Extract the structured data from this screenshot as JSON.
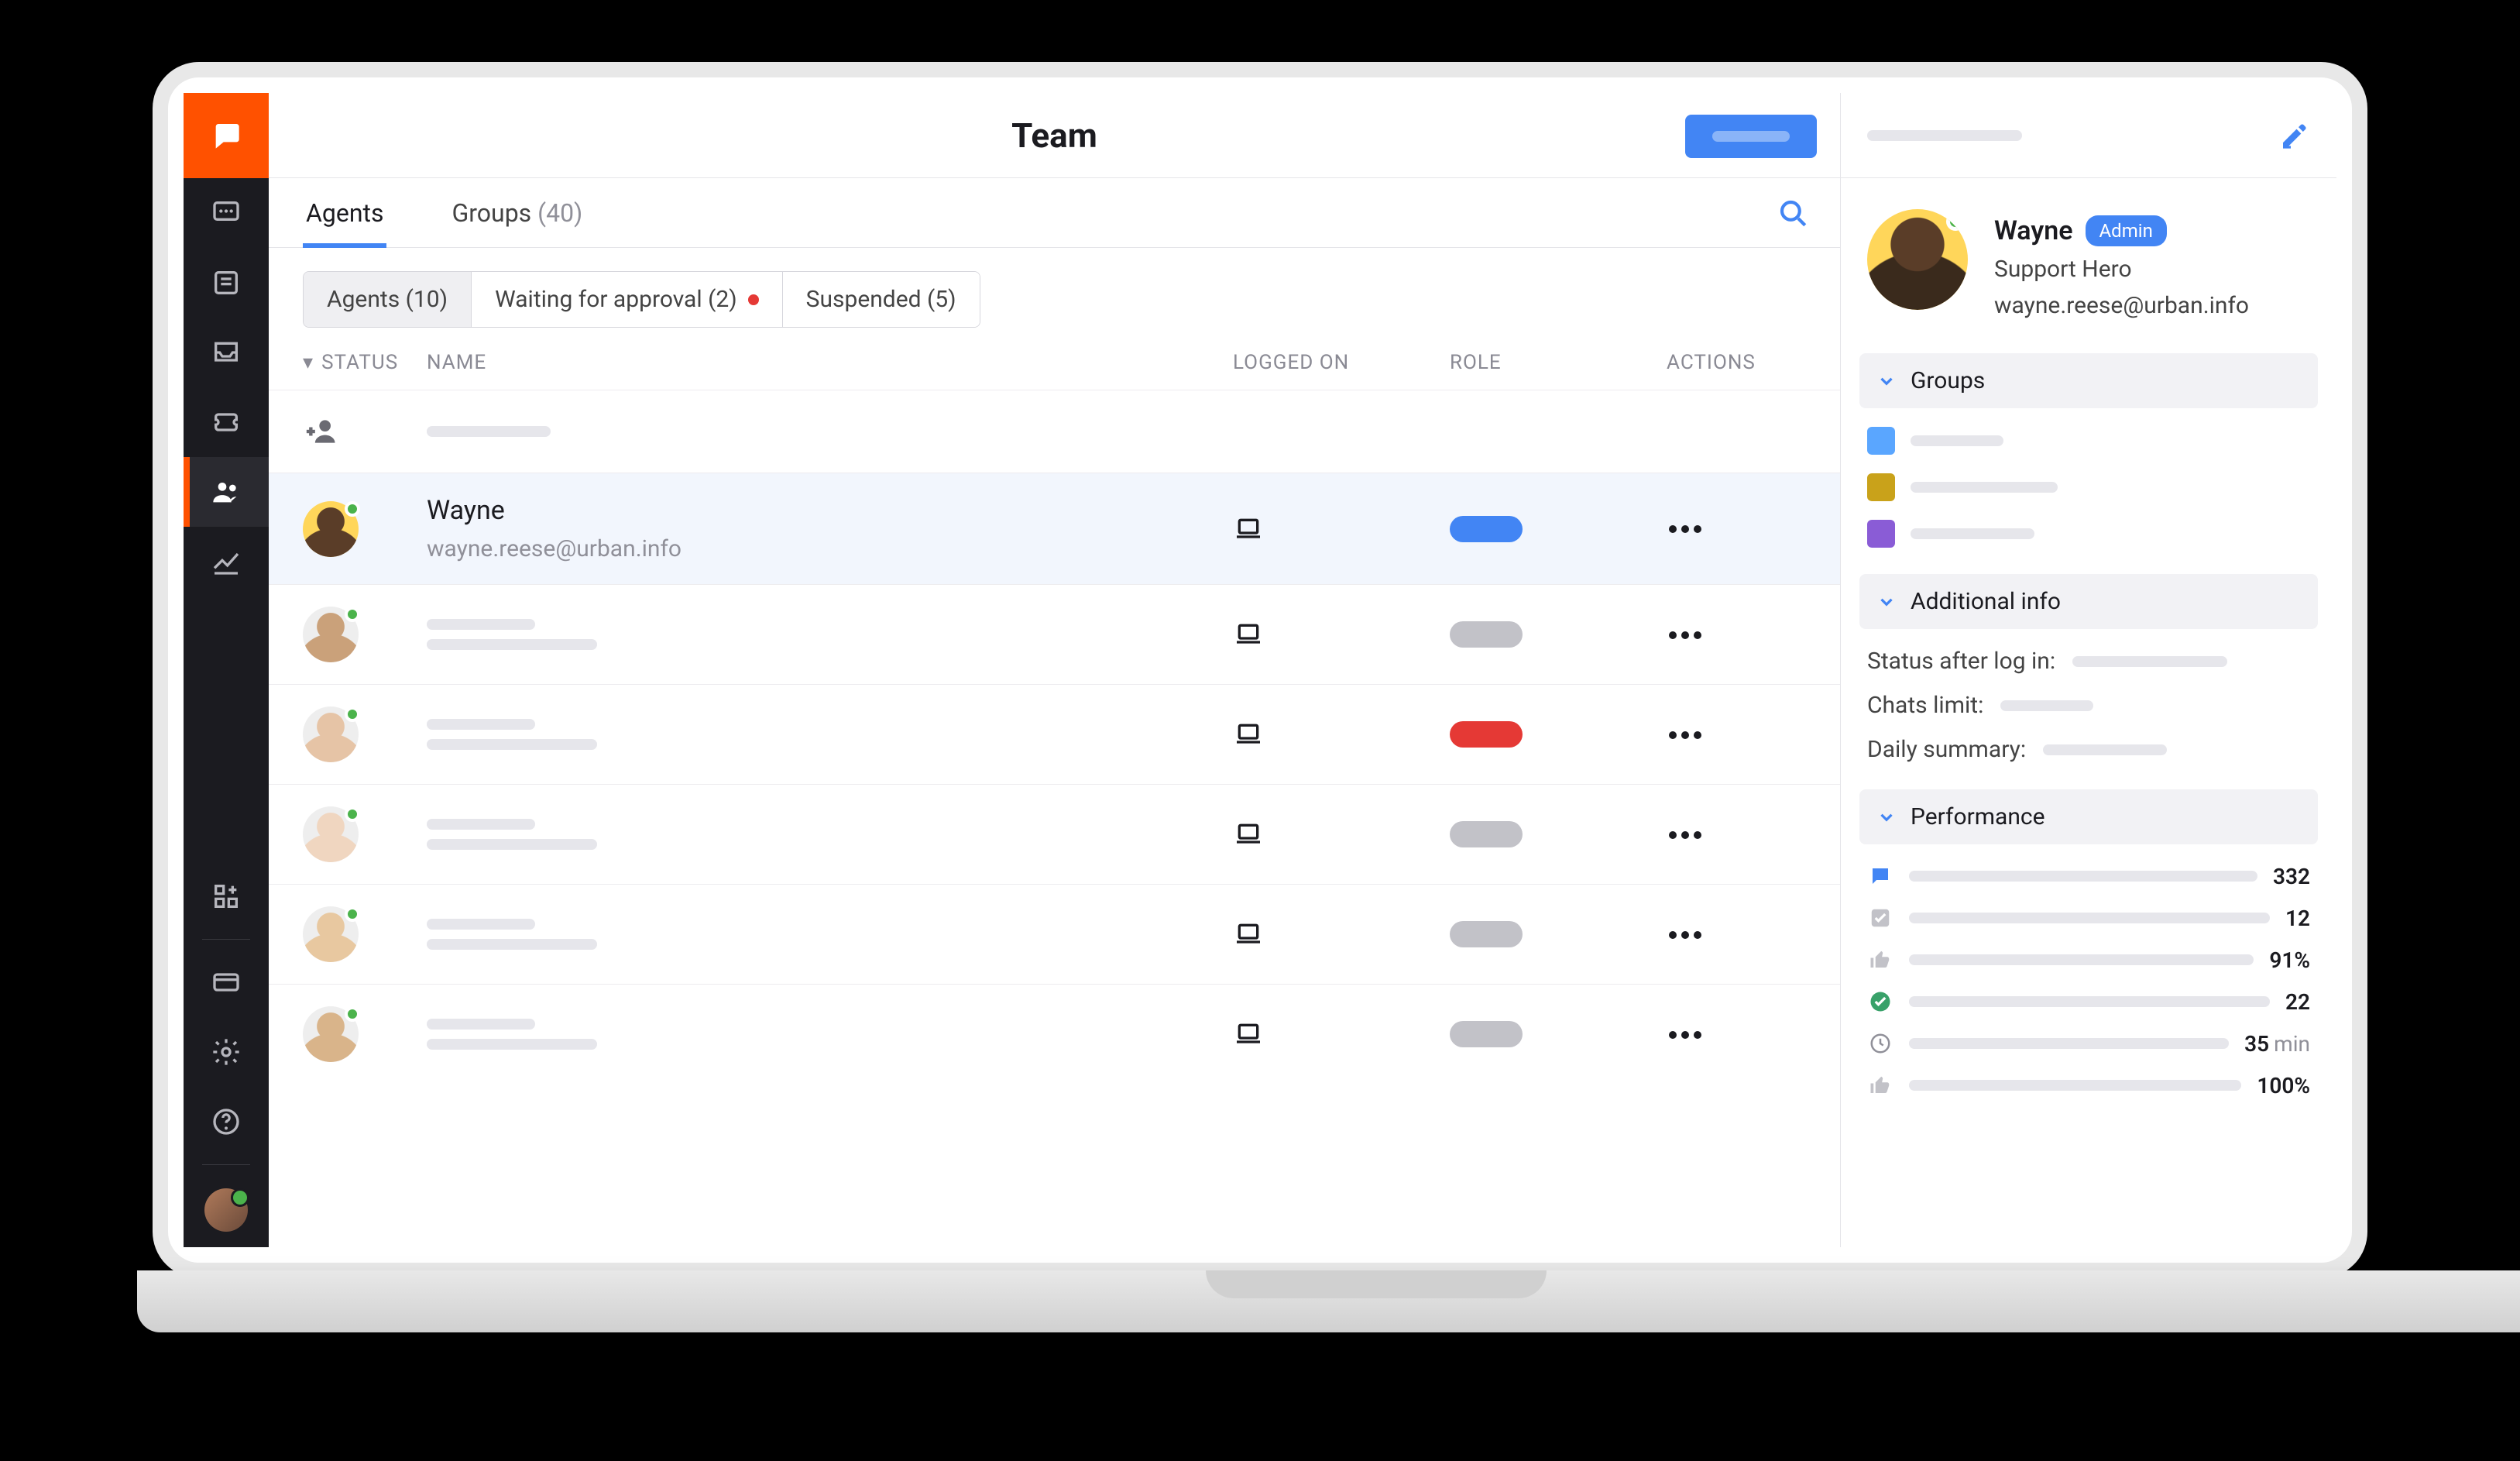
{
  "header": {
    "title": "Team"
  },
  "tabs": {
    "agents": {
      "label": "Agents"
    },
    "groups": {
      "label": "Groups",
      "count": "(40)"
    }
  },
  "segments": {
    "agents": "Agents (10)",
    "waiting": "Waiting for approval (2)",
    "suspended": "Suspended (5)"
  },
  "columns": {
    "status": "STATUS",
    "name": "NAME",
    "logged": "LOGGED ON",
    "role": "ROLE",
    "actions": "ACTIONS"
  },
  "selected_agent": {
    "name": "Wayne",
    "email": "wayne.reese@urban.info"
  },
  "profile": {
    "name": "Wayne",
    "badge": "Admin",
    "title": "Support Hero",
    "email": "wayne.reese@urban.info"
  },
  "sections": {
    "groups": "Groups",
    "additional": "Additional info",
    "performance": "Performance"
  },
  "groups_colors": [
    "#5aa6ff",
    "#c9a21a",
    "#8a5cd6"
  ],
  "additional": {
    "status_after_login": "Status after log in:",
    "chats_limit": "Chats limit:",
    "daily_summary": "Daily summary:"
  },
  "performance": [
    {
      "icon": "chat",
      "value": "332",
      "unit": ""
    },
    {
      "icon": "check",
      "value": "12",
      "unit": ""
    },
    {
      "icon": "thumb",
      "value": "91%",
      "unit": ""
    },
    {
      "icon": "ok",
      "value": "22",
      "unit": ""
    },
    {
      "icon": "clock",
      "value": "35",
      "unit": "min"
    },
    {
      "icon": "thumb",
      "value": "100%",
      "unit": ""
    }
  ],
  "agent_rows": [
    {
      "pill": "",
      "avatar": "add"
    },
    {
      "pill": "blue",
      "name": "Wayne",
      "email": "wayne.reese@urban.info",
      "selected": true,
      "skin": "#5a3d28",
      "bg": "#ffd65a"
    },
    {
      "pill": "grey",
      "skin": "#caa17a",
      "bg": "#eee"
    },
    {
      "pill": "red",
      "skin": "#e6c4a6",
      "bg": "#eee"
    },
    {
      "pill": "grey",
      "skin": "#f0d6c0",
      "bg": "#eee"
    },
    {
      "pill": "grey",
      "skin": "#e8c8a0",
      "bg": "#eee"
    },
    {
      "pill": "grey",
      "skin": "#d9b48a",
      "bg": "#eee"
    }
  ]
}
